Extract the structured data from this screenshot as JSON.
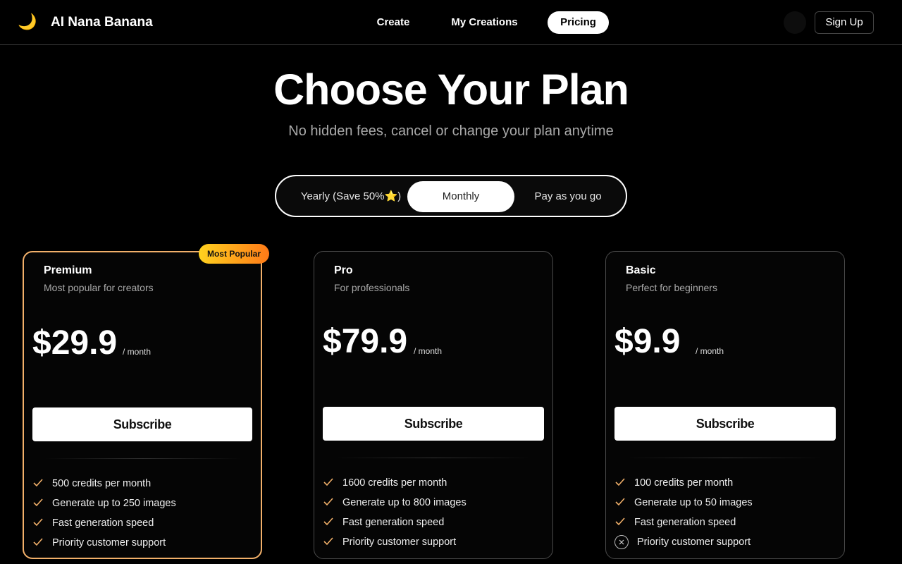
{
  "header": {
    "logo_icon": "crescent-moon-icon",
    "brand": "AI Nana Banana",
    "nav": [
      {
        "label": "Create"
      },
      {
        "label": "My Creations"
      },
      {
        "label": "Pricing",
        "active": true
      }
    ],
    "signup_label": "Sign Up"
  },
  "hero": {
    "title": "Choose Your Plan",
    "subtitle": "No hidden fees, cancel or change your plan anytime"
  },
  "billing": {
    "options": [
      "Yearly (Save 50%⭐)",
      "Monthly",
      "Pay as you go"
    ],
    "selected": "Monthly"
  },
  "colors": {
    "accent_border": "#f2b06a",
    "badge_gradient_start": "#ffd21f",
    "badge_gradient_end": "#ff7a18",
    "check": "#f2b06a"
  },
  "plans": [
    {
      "name": "Premium",
      "description": "Most popular for creators",
      "price": "$29.9",
      "period": "/ month",
      "badge": "Most Popular",
      "cta": "Subscribe",
      "features": [
        {
          "text": "500 credits per month",
          "included": true
        },
        {
          "text": "Generate up to 250 images",
          "included": true
        },
        {
          "text": "Fast generation speed",
          "included": true
        },
        {
          "text": "Priority customer support",
          "included": true
        }
      ]
    },
    {
      "name": "Pro",
      "description": "For professionals",
      "price": "$79.9",
      "period": "/ month",
      "cta": "Subscribe",
      "features": [
        {
          "text": "1600 credits per month",
          "included": true
        },
        {
          "text": "Generate up to 800 images",
          "included": true
        },
        {
          "text": "Fast generation speed",
          "included": true
        },
        {
          "text": "Priority customer support",
          "included": true
        }
      ]
    },
    {
      "name": "Basic",
      "description": "Perfect for beginners",
      "price": "$9.9",
      "period": "/ month",
      "cta": "Subscribe",
      "features": [
        {
          "text": "100 credits per month",
          "included": true
        },
        {
          "text": "Generate up to 50 images",
          "included": true
        },
        {
          "text": "Fast generation speed",
          "included": true
        },
        {
          "text": "Priority customer support",
          "included": false
        }
      ]
    }
  ]
}
